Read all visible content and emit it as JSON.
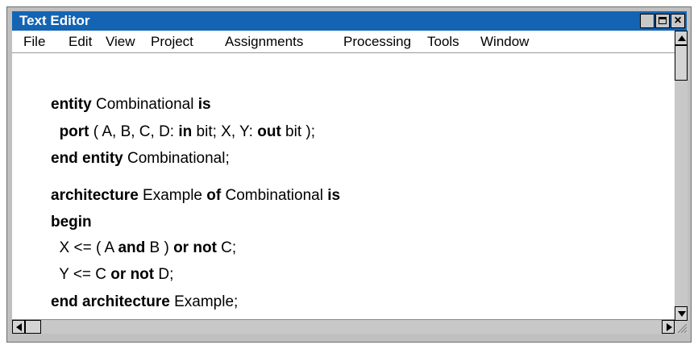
{
  "window": {
    "title": "Text Editor",
    "controls": [
      "minimize-icon",
      "maximize-icon",
      "close-icon"
    ],
    "close_glyph": "×"
  },
  "menu": [
    "File",
    "Edit",
    "View",
    "Project",
    "Assignments",
    "Processing",
    "Tools",
    "Window"
  ],
  "code": [
    [
      {
        "t": "entity",
        "b": true
      },
      {
        "t": " Combinational "
      },
      {
        "t": "is",
        "b": true
      }
    ],
    [
      {
        "t": "  "
      },
      {
        "t": "port",
        "b": true
      },
      {
        "t": " ( A, B, C, D: "
      },
      {
        "t": "in",
        "b": true
      },
      {
        "t": " bit; X, Y: "
      },
      {
        "t": "out",
        "b": true
      },
      {
        "t": " bit );"
      }
    ],
    [
      {
        "t": "end entity",
        "b": true
      },
      {
        "t": " Combinational;"
      }
    ],
    [
      {
        "t": "architecture",
        "b": true
      },
      {
        "t": " Example "
      },
      {
        "t": "of",
        "b": true
      },
      {
        "t": " Combinational "
      },
      {
        "t": "is",
        "b": true
      }
    ],
    [
      {
        "t": "begin",
        "b": true
      }
    ],
    [
      {
        "t": "  X <= ( A "
      },
      {
        "t": "and",
        "b": true
      },
      {
        "t": " B ) "
      },
      {
        "t": "or not",
        "b": true
      },
      {
        "t": " C;"
      }
    ],
    [
      {
        "t": "  Y <= C "
      },
      {
        "t": "or not",
        "b": true
      },
      {
        "t": " D;"
      }
    ],
    [
      {
        "t": "end architecture",
        "b": true
      },
      {
        "t": " Example;"
      }
    ]
  ],
  "colors": {
    "titlebar": "#1464b4",
    "frame": "#c0c0c0",
    "editor_bg": "#ffffff"
  }
}
